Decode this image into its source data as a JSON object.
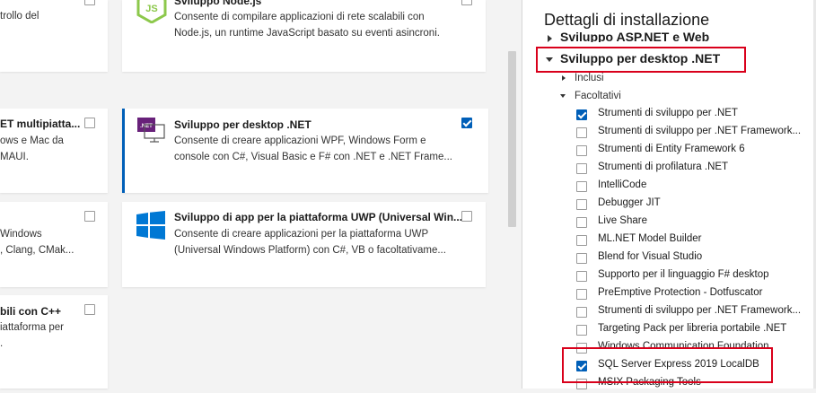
{
  "cards": [
    {
      "id": "tl",
      "title": "",
      "lines": [
        "trollo del"
      ],
      "checked": false
    },
    {
      "id": "node",
      "title": "Sviluppo Node.js",
      "lines": [
        "Consente di compilare applicazioni di rete scalabili con",
        "Node.js, un runtime JavaScript basato su eventi asincroni."
      ],
      "checked": false
    },
    {
      "id": "maui",
      "title": "ET multipiatta...",
      "lines": [
        "ows e Mac da",
        "MAUI."
      ],
      "checked": false
    },
    {
      "id": "dotnet",
      "title": "Sviluppo per desktop .NET",
      "lines": [
        "Consente di creare applicazioni WPF, Windows Form e",
        "console con C#, Visual Basic e F# con .NET e .NET Frame..."
      ],
      "checked": true
    },
    {
      "id": "cpp",
      "title": "",
      "lines": [
        "Windows",
        ", Clang, CMak..."
      ],
      "checked": false
    },
    {
      "id": "uwp",
      "title": "Sviluppo di app per la piattaforma UWP (Universal Win...",
      "lines": [
        "Consente di creare applicazioni per la piattaforma UWP",
        "(Universal Windows Platform) con C#, VB o facoltativame..."
      ],
      "checked": false
    },
    {
      "id": "mobile",
      "title": "bili con C++",
      "lines": [
        "iattaforma per",
        "."
      ],
      "checked": false
    }
  ],
  "icons": {
    "node": "nodejs-icon",
    "dotnet": "dotnet-desktop-icon",
    "uwp": "windows-logo-icon"
  },
  "dotnet_badge": ".NET",
  "node_badge": "JS",
  "details": {
    "title": "Dettagli di installazione",
    "prev_workload": "Sviluppo ASP.NET e Web",
    "workload": "Sviluppo per desktop .NET",
    "included": "Inclusi",
    "optional": "Facoltativi",
    "items": [
      {
        "label": "Strumenti di sviluppo per .NET",
        "checked": true
      },
      {
        "label": "Strumenti di sviluppo per .NET Framework...",
        "checked": false
      },
      {
        "label": "Strumenti di Entity Framework 6",
        "checked": false
      },
      {
        "label": "Strumenti di profilatura .NET",
        "checked": false
      },
      {
        "label": "IntelliCode",
        "checked": false
      },
      {
        "label": "Debugger JIT",
        "checked": false
      },
      {
        "label": "Live Share",
        "checked": false
      },
      {
        "label": "ML.NET Model Builder",
        "checked": false
      },
      {
        "label": "Blend for Visual Studio",
        "checked": false
      },
      {
        "label": "Supporto per il linguaggio F# desktop",
        "checked": false
      },
      {
        "label": "PreEmptive Protection - Dotfuscator",
        "checked": false
      },
      {
        "label": "Strumenti di sviluppo per .NET Framework...",
        "checked": false
      },
      {
        "label": "Targeting Pack per libreria portabile .NET",
        "checked": false
      },
      {
        "label": "Windows Communication Foundation",
        "checked": false
      },
      {
        "label": "SQL Server Express 2019 LocalDB",
        "checked": true
      },
      {
        "label": "MSIX Packaging Tools",
        "checked": false
      }
    ]
  },
  "colors": {
    "accent": "#005fb8",
    "highlight": "#d9001b",
    "dotnet_purple": "#68217a",
    "node_green": "#8cc84b",
    "windows_blue": "#0078d4"
  }
}
